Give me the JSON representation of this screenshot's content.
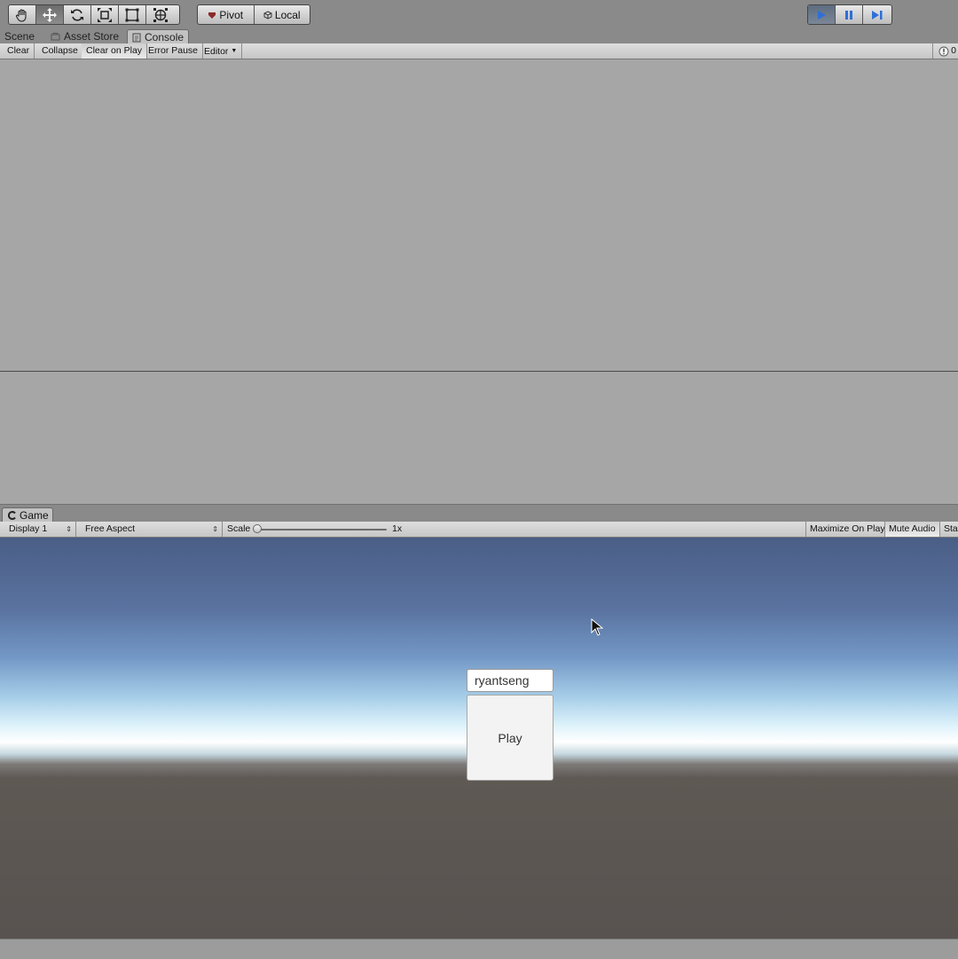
{
  "toolbar": {
    "transform_tools": [
      {
        "icon": "hand-icon",
        "active": false
      },
      {
        "icon": "move-icon",
        "active": true
      },
      {
        "icon": "rotate-icon",
        "active": false
      },
      {
        "icon": "scale-icon",
        "active": false
      },
      {
        "icon": "rect-icon",
        "active": false
      },
      {
        "icon": "transform-icon",
        "active": false
      }
    ],
    "pivot_label": "Pivot",
    "local_label": "Local",
    "play_controls": [
      {
        "icon": "play-icon",
        "active": true
      },
      {
        "icon": "pause-icon",
        "active": false
      },
      {
        "icon": "step-icon",
        "active": false
      }
    ],
    "accent_color": "#2f6fd6"
  },
  "tabs": {
    "scene": "Scene",
    "asset_store": "Asset Store",
    "console": "Console"
  },
  "console": {
    "clear": "Clear",
    "collapse": "Collapse",
    "clear_on_play": "Clear on Play",
    "error_pause": "Error Pause",
    "editor": "Editor",
    "error_count": "0"
  },
  "game": {
    "tab_label": "Game",
    "display": "Display 1",
    "aspect": "Free Aspect",
    "scale_label": "Scale",
    "scale_value": "1x",
    "maximize_on_play": "Maximize On Play",
    "mute_audio": "Mute Audio",
    "stats": "Stats",
    "name_input_value": "ryantseng",
    "play_button_label": "Play"
  }
}
